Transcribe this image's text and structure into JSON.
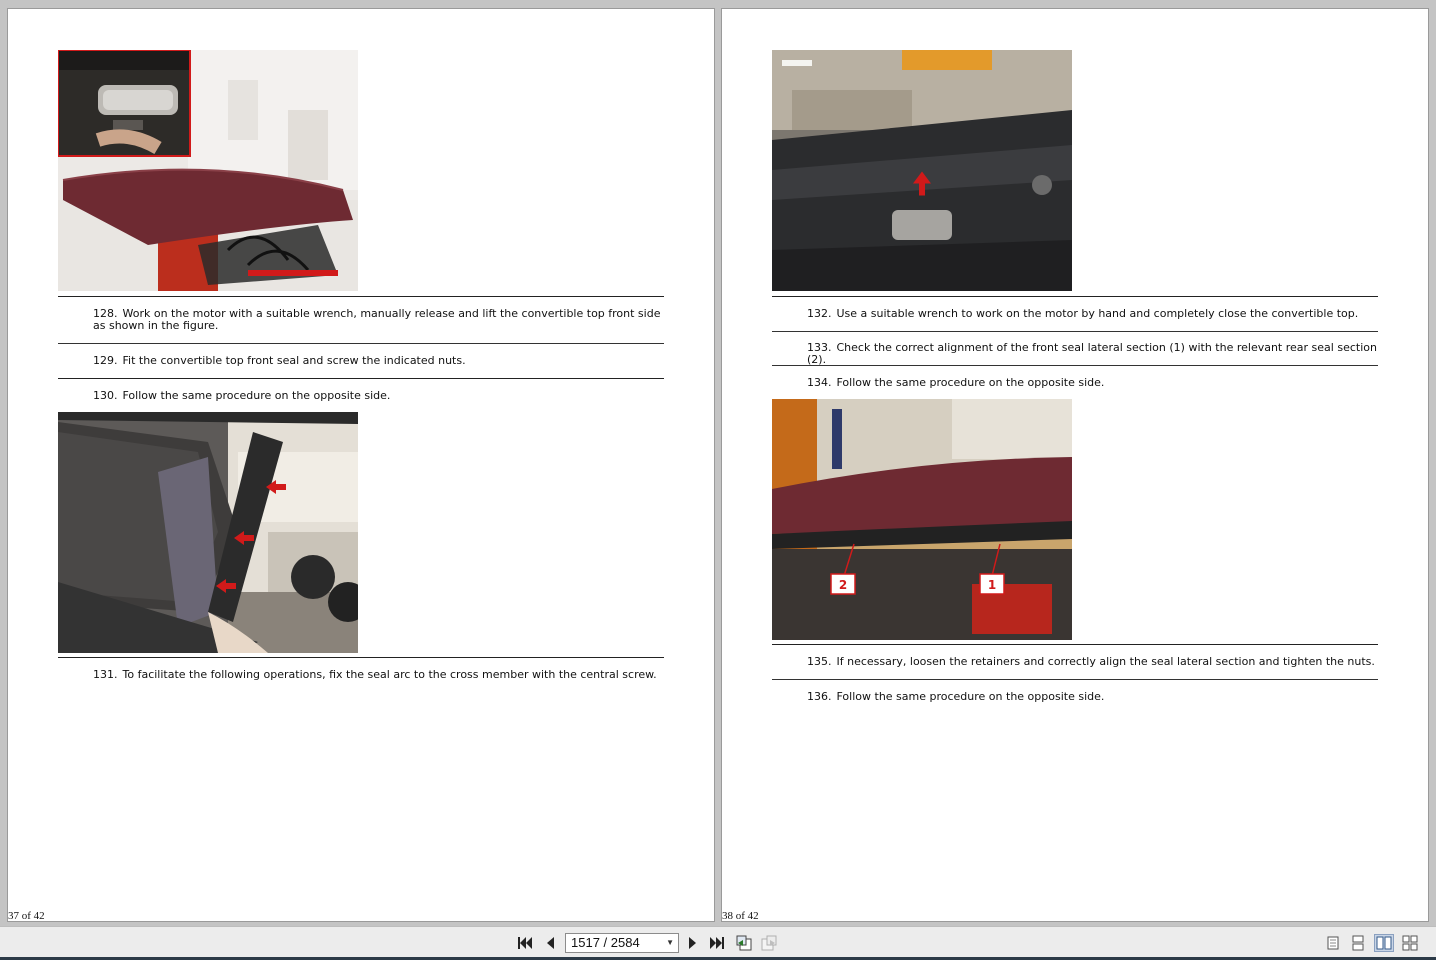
{
  "viewer": {
    "current_page": "1517 / 2584",
    "left_page": {
      "footer": "37 of 42",
      "steps": [
        {
          "num": "128.",
          "text": "Work on the motor with a suitable wrench, manually release and lift the convertible top front side as shown in the figure."
        },
        {
          "num": "129.",
          "text": "Fit the convertible top front seal and screw the indicated nuts."
        },
        {
          "num": "130.",
          "text": "Follow the same procedure on the opposite side."
        },
        {
          "num": "131.",
          "text": "To facilitate the following operations, fix the seal arc to the cross member with the central screw."
        }
      ]
    },
    "right_page": {
      "footer": "38 of 42",
      "steps": [
        {
          "num": "132.",
          "text": "Use a suitable wrench to work on the motor by hand and completely close the convertible top."
        },
        {
          "num": "133.",
          "text": "Check the correct alignment of the front seal lateral section (1) with the relevant rear seal section (2)."
        },
        {
          "num": "134.",
          "text": "Follow the same procedure on the opposite side."
        },
        {
          "num": "135.",
          "text": "If necessary, loosen the retainers and correctly align the seal lateral section and tighten the nuts."
        },
        {
          "num": "136.",
          "text": "Follow the same procedure on the opposite side."
        }
      ],
      "callouts": [
        "2",
        "1"
      ]
    }
  },
  "toolbar": {
    "icons": [
      "first-page-icon",
      "previous-page-icon",
      "next-page-icon",
      "last-page-icon",
      "go-back-icon",
      "go-forward-icon"
    ],
    "view_modes": [
      "single-page-icon",
      "continuous-icon",
      "two-page-icon",
      "two-page-continuous-icon"
    ],
    "active_view": "two-page-icon"
  },
  "colors": {
    "accent_red": "#d11a1a",
    "roof_maroon": "#6e2a32",
    "viewer_bg": "#c4c4c4"
  }
}
